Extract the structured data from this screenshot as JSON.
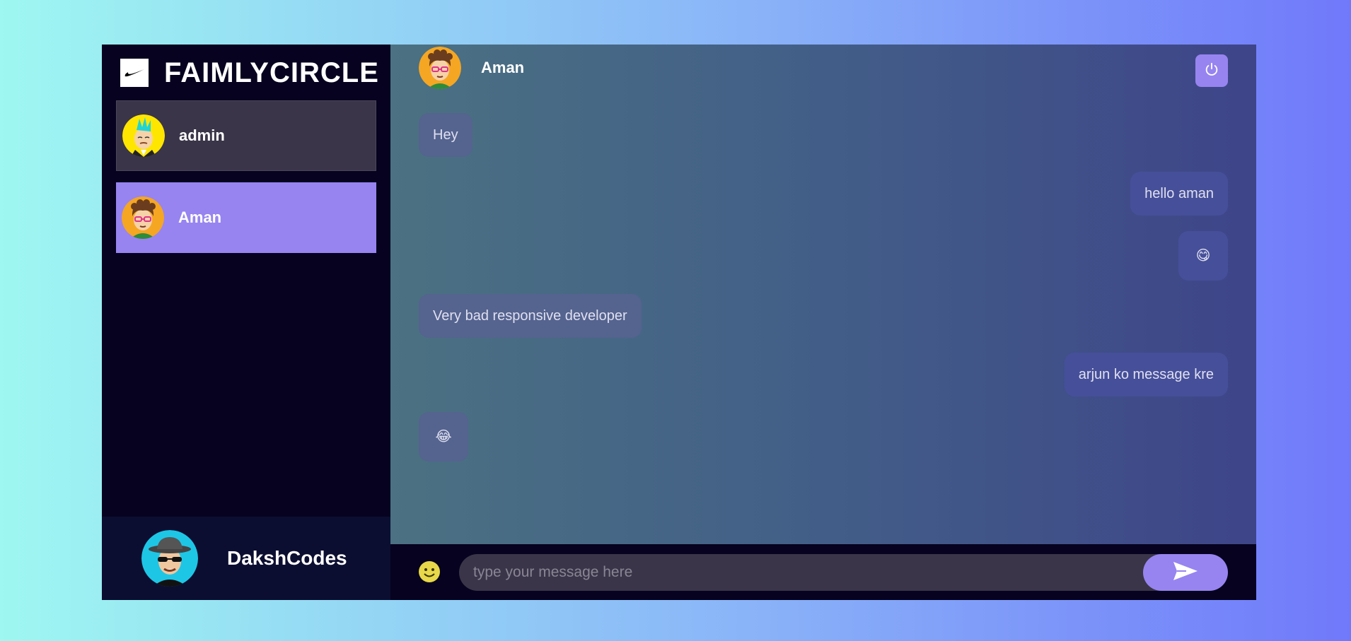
{
  "app": {
    "title": "FAIMLYCIRCLE"
  },
  "contacts": [
    {
      "name": "admin",
      "avatar": "avatar-admin"
    },
    {
      "name": "Aman",
      "avatar": "avatar-aman",
      "selected": true
    }
  ],
  "current_user": {
    "name": "DakshCodes",
    "avatar": "avatar-daksh"
  },
  "chat": {
    "recipient": "Aman",
    "messages": [
      {
        "text": "Hey",
        "direction": "incoming"
      },
      {
        "text": "hello aman",
        "direction": "outgoing"
      },
      {
        "text": "😋",
        "direction": "outgoing"
      },
      {
        "text": "Very bad responsive developer",
        "direction": "incoming"
      },
      {
        "text": "arjun ko message kre",
        "direction": "outgoing"
      },
      {
        "text": "😂",
        "direction": "incoming"
      }
    ]
  },
  "composer": {
    "placeholder": "type your message here"
  },
  "icons": {
    "logo": "swoosh-logo",
    "logout": "power-icon",
    "emoji": "smiley-icon",
    "send": "send-icon"
  },
  "colors": {
    "accent": "#9784f0",
    "sidebar_bg": "#06021f",
    "incoming_bubble": "#55638f",
    "outgoing_bubble": "#464f99"
  }
}
